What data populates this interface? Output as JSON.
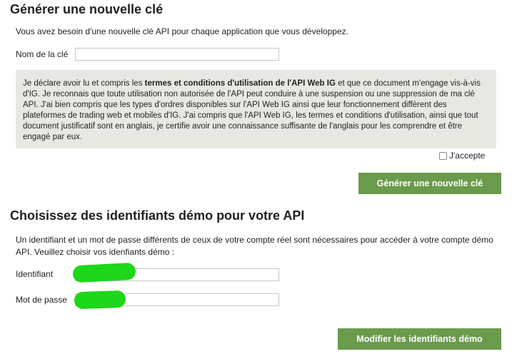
{
  "section1": {
    "title": "Générer une nouvelle clé",
    "description": "Vous avez besoin d'une nouvelle clé API pour chaque application que vous développez.",
    "key_name_label": "Nom de la clé",
    "key_name_value": "",
    "terms_prefix": "Je déclare avoir lu et compris les ",
    "terms_bold": "termes et conditions d'utilisation de l'API Web IG",
    "terms_suffix": " et que ce document m'engage vis-à-vis d'IG. Je reconnais que toute utilisation non autorisée de l'API peut conduire à une suspension ou une suppression de ma clé API. J'ai bien compris que les types d'ordres disponibles sur l'API Web IG ainsi que leur fonctionnement diffèrent des plateformes de trading web et mobiles d'IG. J'ai compris que l'API Web IG, les termes et conditions d'utilisation, ainsi que tout document justificatif sont en anglais, je certifie avoir une connaissance suffisante de l'anglais pour les comprendre et être engagé par eux.",
    "accept_label": "J'accepte",
    "accept_checked": false,
    "generate_button": "Générer une nouvelle clé"
  },
  "section2": {
    "title": "Choisissez des identifiants démo pour votre API",
    "description": "Un identifiant et un mot de passe différents de ceux de votre compte réel sont nécessaires pour accéder à votre compte démo API. Veuillez choisir vos idenfiants démo :",
    "identifier_label": "Identifiant",
    "password_label": "Mot de passe",
    "modify_button": "Modifier les identifiants démo"
  },
  "colors": {
    "button_green": "#6a9a4b",
    "terms_background": "#e8e8e3",
    "redaction_green": "#1ed61a"
  }
}
